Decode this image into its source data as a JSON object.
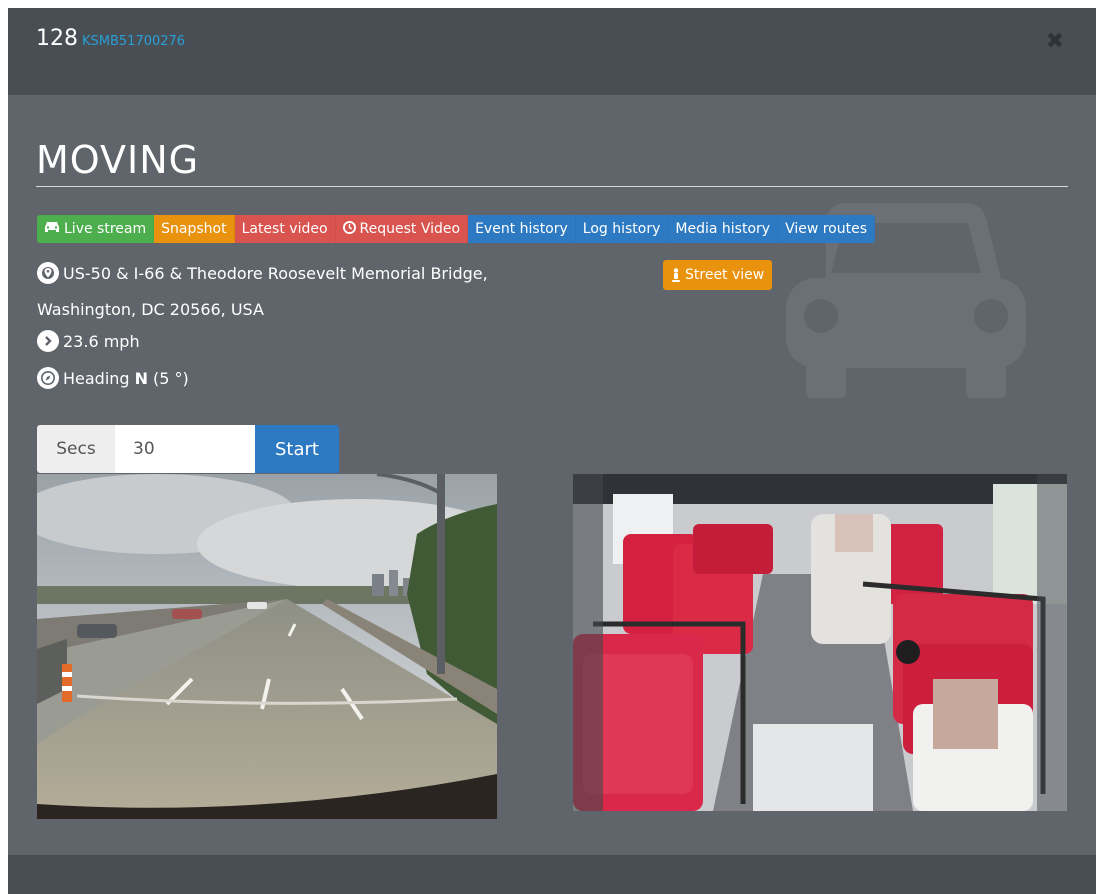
{
  "header": {
    "vehicle_number": "128",
    "vehicle_id": "KSMB51700276",
    "close_symbol": "✖"
  },
  "status": {
    "title": "MOVING"
  },
  "actions": {
    "live_stream": "Live stream",
    "snapshot": "Snapshot",
    "latest_video": "Latest video",
    "request_video": "Request Video",
    "event_history": "Event history",
    "log_history": "Log history",
    "media_history": "Media history",
    "view_routes": "View routes"
  },
  "location": {
    "address_line1": "US-50 & I-66 & Theodore Roosevelt Memorial Bridge,",
    "address_line2": "Washington, DC 20566, USA",
    "street_view_label": "Street view"
  },
  "telemetry": {
    "speed": "23.6 mph",
    "heading_label": "Heading",
    "heading_direction": "N",
    "heading_degrees": "(5 °)"
  },
  "video_request": {
    "secs_label": "Secs",
    "secs_value": "30",
    "start_label": "Start"
  },
  "colors": {
    "modal_bg": "#5f656b",
    "header_bg": "#484e54",
    "green": "#4cae4c",
    "orange": "#e8920d",
    "red": "#d9534f",
    "blue": "#2e7ac2",
    "id_link": "#2a9fd6"
  },
  "icons": {
    "live_stream": "car-icon",
    "request_video": "clock-icon",
    "street_view": "street-view-person-icon",
    "address": "globe-map-pin-icon",
    "speed": "chevron-right-circle-icon",
    "heading": "compass-icon",
    "close": "close-icon",
    "background": "car-silhouette-icon"
  }
}
